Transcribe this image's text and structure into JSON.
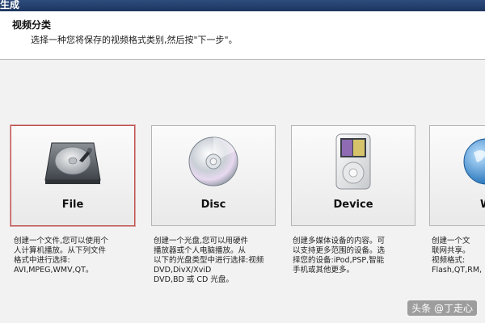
{
  "window": {
    "title": "生成"
  },
  "header": {
    "heading": "视频分类",
    "instruction": "选择一种您将保存的视频格式类别,然后按\"下一步\"。"
  },
  "categories": [
    {
      "label": "File",
      "icon": "hard-disk-icon",
      "selected": true,
      "description": "创建一个文件,您可以使用个\n人计算机播放。从下列文件\n格式中进行选择:\nAVI,MPEG,WMV,QT。"
    },
    {
      "label": "Disc",
      "icon": "disc-icon",
      "selected": false,
      "description": "创建一个光盘,您可以用硬件\n播放器或个人电脑播放。从\n以下的光盘类型中进行选择:视频 DVD,DivX/XviD\nDVD,BD 或 CD 光盘。"
    },
    {
      "label": "Device",
      "icon": "media-player-icon",
      "selected": false,
      "description": "创建多媒体设备的内容。可\n以支持更多范围的设备。选\n择您的设备:iPod,PSP,智能\n手机或其他更多。"
    },
    {
      "label": "W",
      "icon": "globe-icon",
      "selected": false,
      "description": "创建一个文\n联网共享。\n视频格式:\nFlash,QT,RM,"
    }
  ],
  "watermark": "头条 @丁走心",
  "colors": {
    "selected_border": "#c0504d",
    "titlebar": "#1c3560",
    "header_bg": "#ffffff"
  }
}
